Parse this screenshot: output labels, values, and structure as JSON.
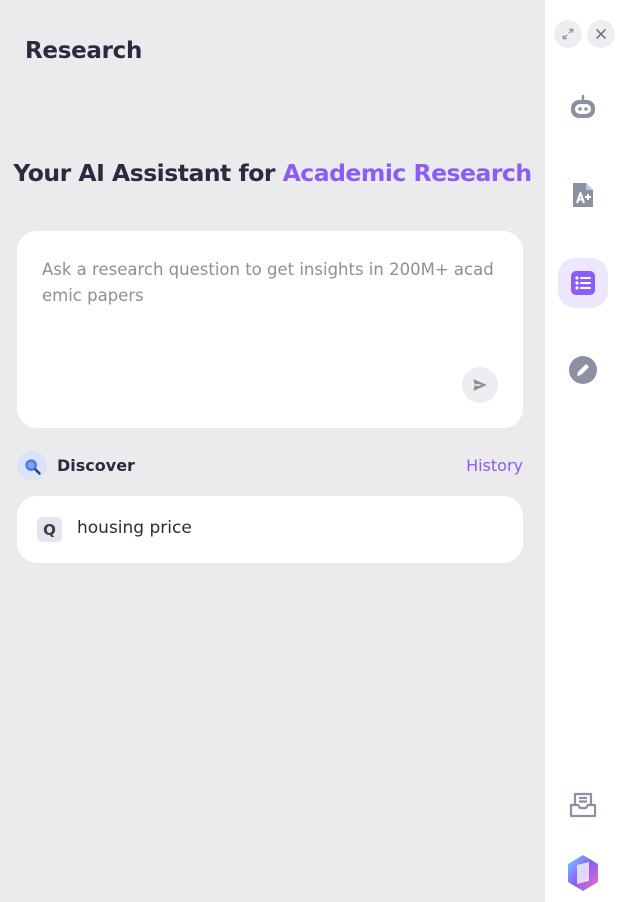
{
  "header": {
    "title": "Research"
  },
  "hero": {
    "prefix": "Your AI Assistant for ",
    "accent": "Academic Research"
  },
  "ask": {
    "placeholder": "Ask a research question to get insights in 200M+ academic papers"
  },
  "discover": {
    "label": "Discover",
    "history_label": "History"
  },
  "queries": [
    {
      "icon": "Q",
      "text": "housing price"
    }
  ],
  "rail": {
    "controls": [
      "expand-icon",
      "close-icon"
    ],
    "items": [
      "chatbot-icon",
      "ai-writing-icon",
      "research-list-icon",
      "edit-icon"
    ],
    "bottom": [
      "inbox-icon",
      "app-logo-icon"
    ],
    "active_item": "research-list-icon"
  },
  "colors": {
    "accent": "#8b5cf6",
    "background": "#ebebee",
    "rail_icon": "#8b90a3"
  }
}
